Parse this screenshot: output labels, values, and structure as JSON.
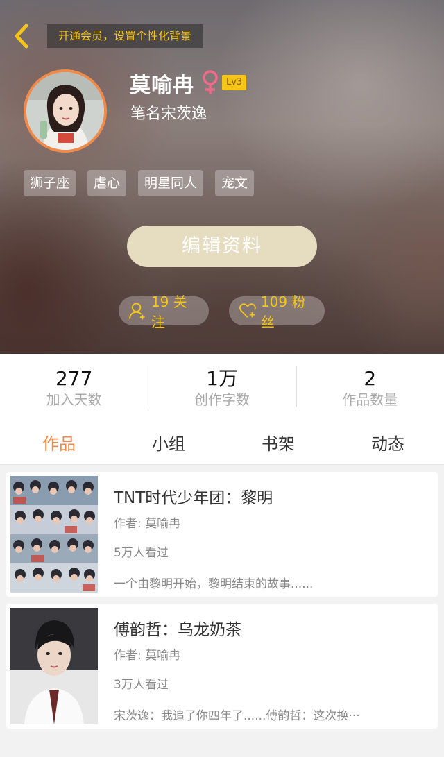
{
  "header": {
    "vip_banner": "开通会员，设置个性化背景",
    "username": "莫喻冉",
    "level": "Lv3",
    "pen_name": "笔名宋茨逸",
    "tags": [
      "狮子座",
      "虐心",
      "明星同人",
      "宠文"
    ],
    "edit_button": "编辑资料",
    "following": "19 关注",
    "fans": "109 粉丝"
  },
  "stats": [
    {
      "value": "277",
      "label": "加入天数"
    },
    {
      "value": "1万",
      "label": "创作字数"
    },
    {
      "value": "2",
      "label": "作品数量"
    }
  ],
  "tabs": [
    "作品",
    "小组",
    "书架",
    "动态"
  ],
  "works": [
    {
      "title": "TNT时代少年团：黎明",
      "author": "作者: 莫喻冉",
      "views": "5万人看过",
      "desc": "一个由黎明开始，黎明结束的故事......"
    },
    {
      "title": "傅韵哲：乌龙奶茶",
      "author": "作者: 莫喻冉",
      "views": "3万人看过",
      "desc": "宋茨逸：我追了你四年了......傅韵哲：这次换···"
    }
  ],
  "colors": {
    "accent": "#f08a4b",
    "gold": "#f5c518",
    "female_icon": "#f06a8a"
  },
  "icons": {
    "back": "chevron-left-icon",
    "gender": "female-icon",
    "following": "person-plus-icon",
    "fans": "heart-plus-icon"
  }
}
